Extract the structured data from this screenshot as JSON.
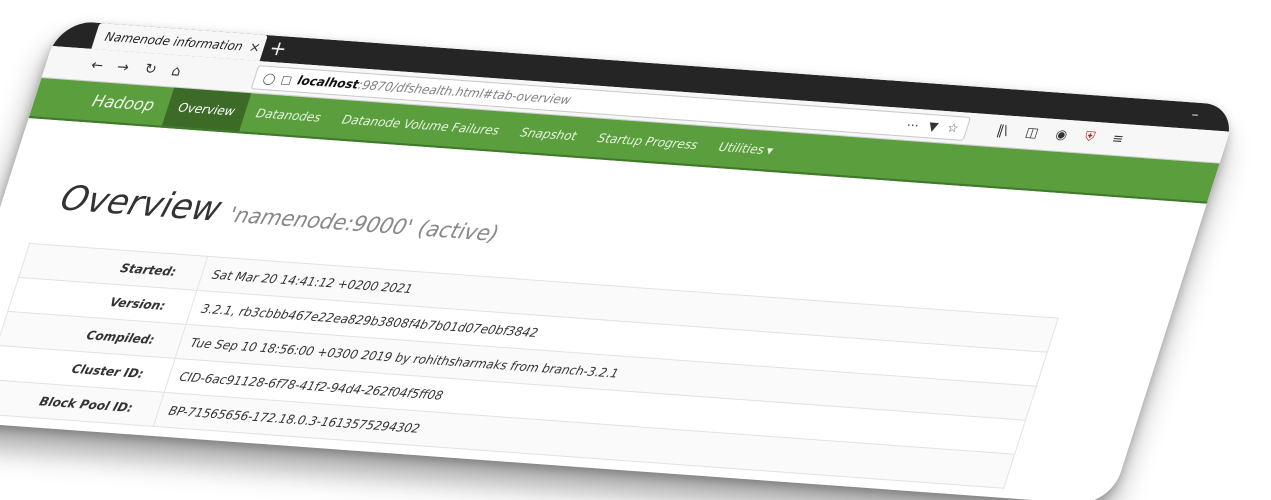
{
  "browser": {
    "tab_title": "Namenode information",
    "tab_close": "×",
    "new_tab": "+",
    "window_minimize": "–",
    "url_host": "localhost",
    "url_rest": ":9870/dfshealth.html#tab-overview",
    "icons": [
      "back-icon",
      "forward-icon",
      "reload-icon",
      "home-icon",
      "shield-icon",
      "page-icon",
      "more-icon",
      "pocket-icon",
      "star-icon",
      "library-icon",
      "sidebar-icon",
      "account-icon",
      "ublock-icon",
      "menu-icon"
    ]
  },
  "hadoop_nav": {
    "brand": "Hadoop",
    "links": [
      "Overview",
      "Datanodes",
      "Datanode Volume Failures",
      "Snapshot",
      "Startup Progress",
      "Utilities"
    ],
    "active": "Overview"
  },
  "overview": {
    "title": "Overview",
    "subtitle": "'namenode:9000' (active)"
  },
  "info_table": [
    {
      "key": "Started:",
      "value": "Sat Mar 20 14:41:12 +0200 2021"
    },
    {
      "key": "Version:",
      "value": "3.2.1, rb3cbbb467e22ea829b3808f4b7b01d07e0bf3842"
    },
    {
      "key": "Compiled:",
      "value": "Tue Sep 10 18:56:00 +0300 2019 by rohithsharmaks from branch-3.2.1"
    },
    {
      "key": "Cluster ID:",
      "value": "CID-6ac91128-6f78-41f2-94d4-262f04f5ff08"
    },
    {
      "key": "Block Pool ID:",
      "value": "BP-71565656-172.18.0.3-1613575294302"
    }
  ],
  "colors": {
    "hadoop_green": "#5a9e3d",
    "active_tab": "#3c6b28",
    "tabbar_dark": "#252526"
  }
}
